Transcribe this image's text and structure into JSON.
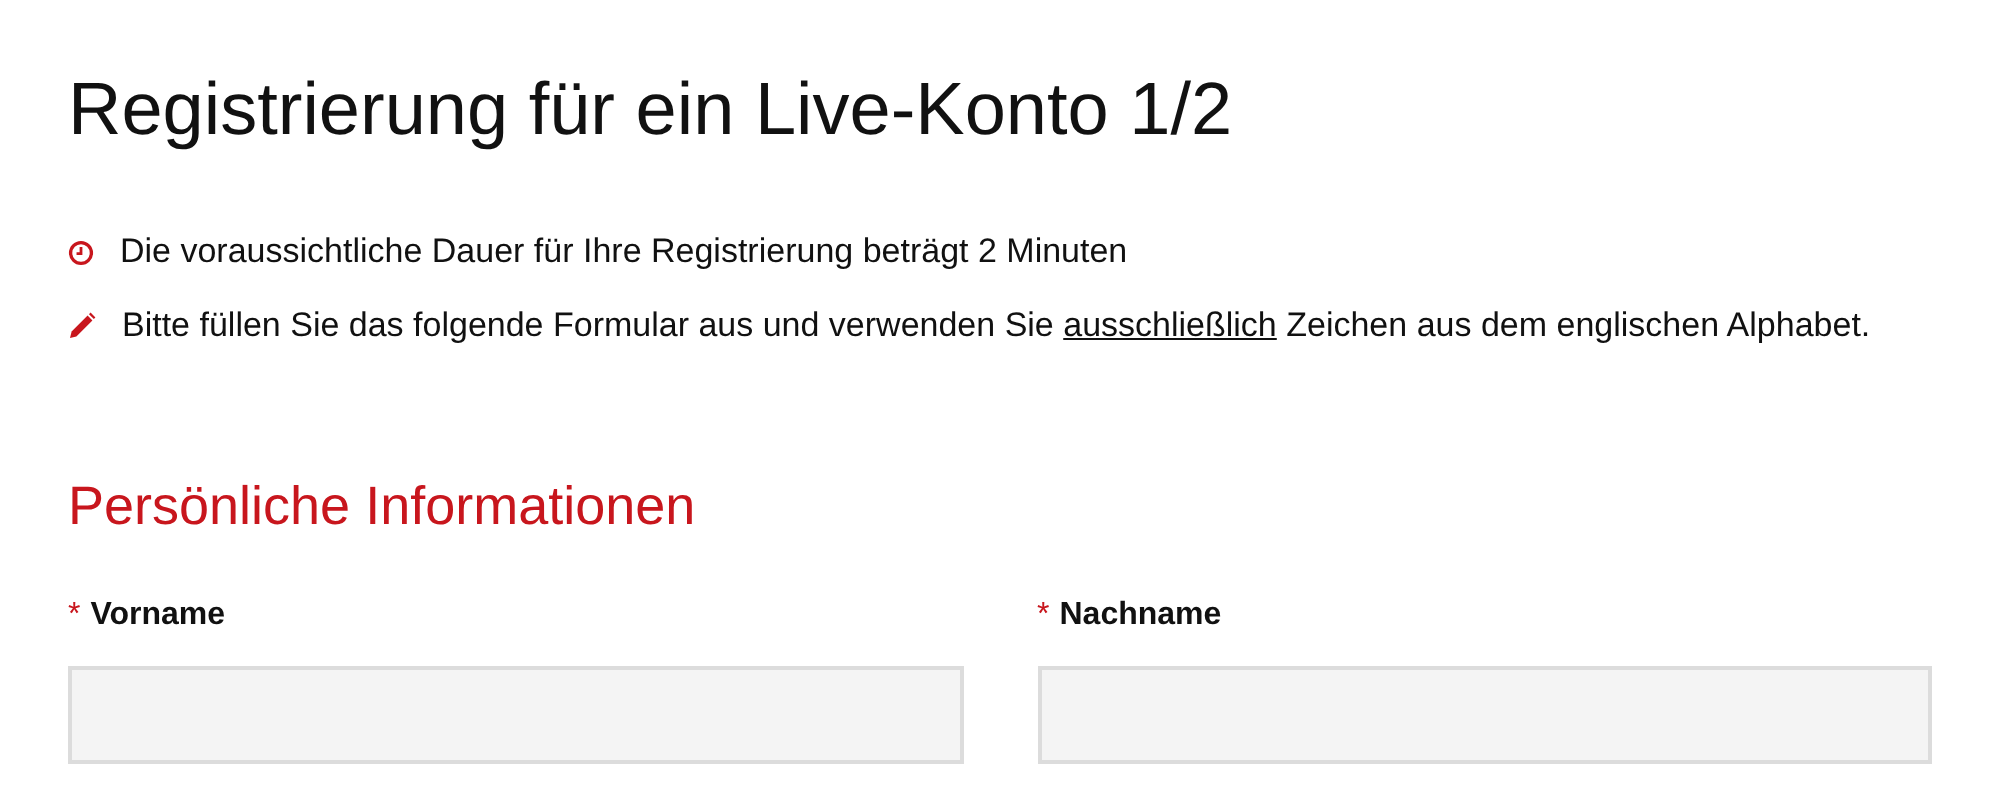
{
  "title": "Registrierung für ein Live-Konto 1/2",
  "notes": [
    {
      "kind": "clock",
      "parts": [
        {
          "text": "Die voraussichtliche Dauer für Ihre Registrierung beträgt 2 Minuten",
          "underlined": false
        }
      ]
    },
    {
      "kind": "pencil",
      "parts": [
        {
          "text": "Bitte füllen Sie das folgende Formular aus und verwenden Sie ",
          "underlined": false
        },
        {
          "text": "ausschließlich",
          "underlined": true
        },
        {
          "text": " Zeichen aus dem englischen Alphabet.",
          "underlined": false
        }
      ]
    }
  ],
  "section": {
    "title": "Persönliche Informationen",
    "fields": [
      {
        "marker": "*",
        "label": "Vorname"
      },
      {
        "marker": "*",
        "label": "Nachname"
      }
    ]
  }
}
